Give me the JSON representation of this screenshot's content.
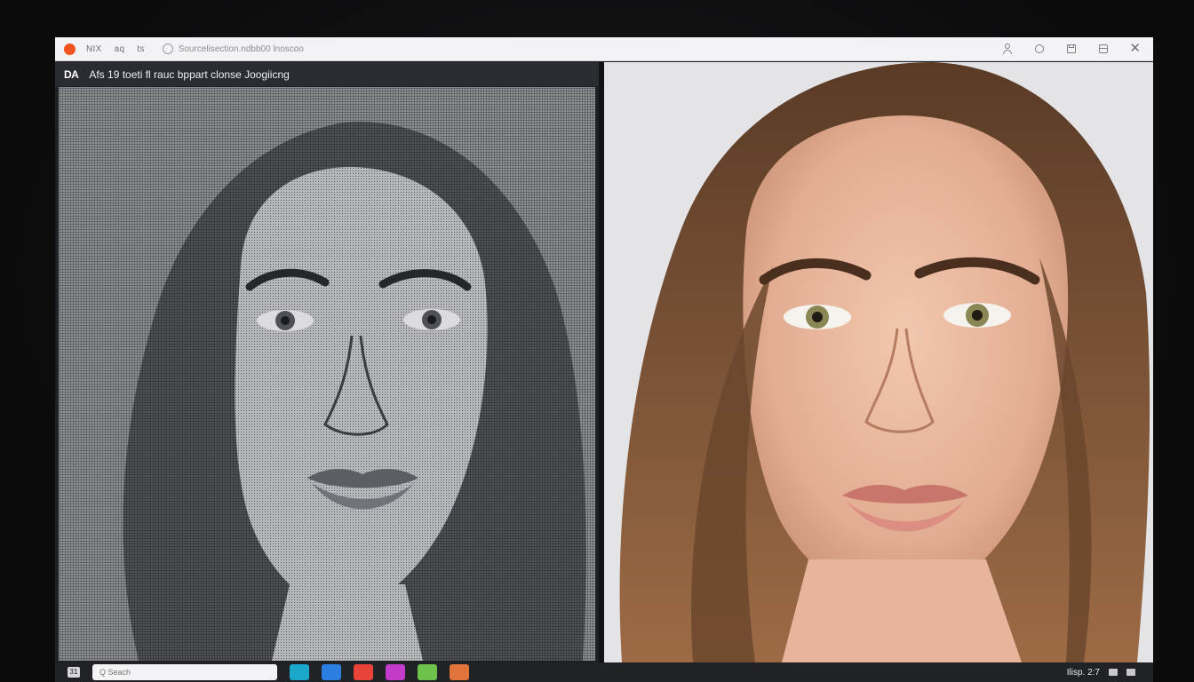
{
  "browser": {
    "menu_items": [
      "NIX",
      "aq",
      "ts"
    ],
    "url": "Sourcelisection.ndbb00 lnoscoo",
    "close_glyph": "✕"
  },
  "left_panel": {
    "logo": "DA",
    "title": "Afs 19 toeti fl rauc bppart clonse Joogiicng",
    "image_description": "monochrome dot-pattern portrait"
  },
  "right_panel": {
    "image_description": "color portrait photograph"
  },
  "taskbar": {
    "start_label": "31",
    "search_placeholder": "Q Seach",
    "apps": [
      "#1aa7c9",
      "#2b7fe0",
      "#e8443a",
      "#c23cc9",
      "#6cc24a",
      "#e0743a"
    ],
    "tray_text": "Ilisp. 2:7"
  },
  "colors": {
    "accent": "#f2541d",
    "chrome_bg": "#f3f3f5",
    "panel_header": "#2a2c31"
  }
}
